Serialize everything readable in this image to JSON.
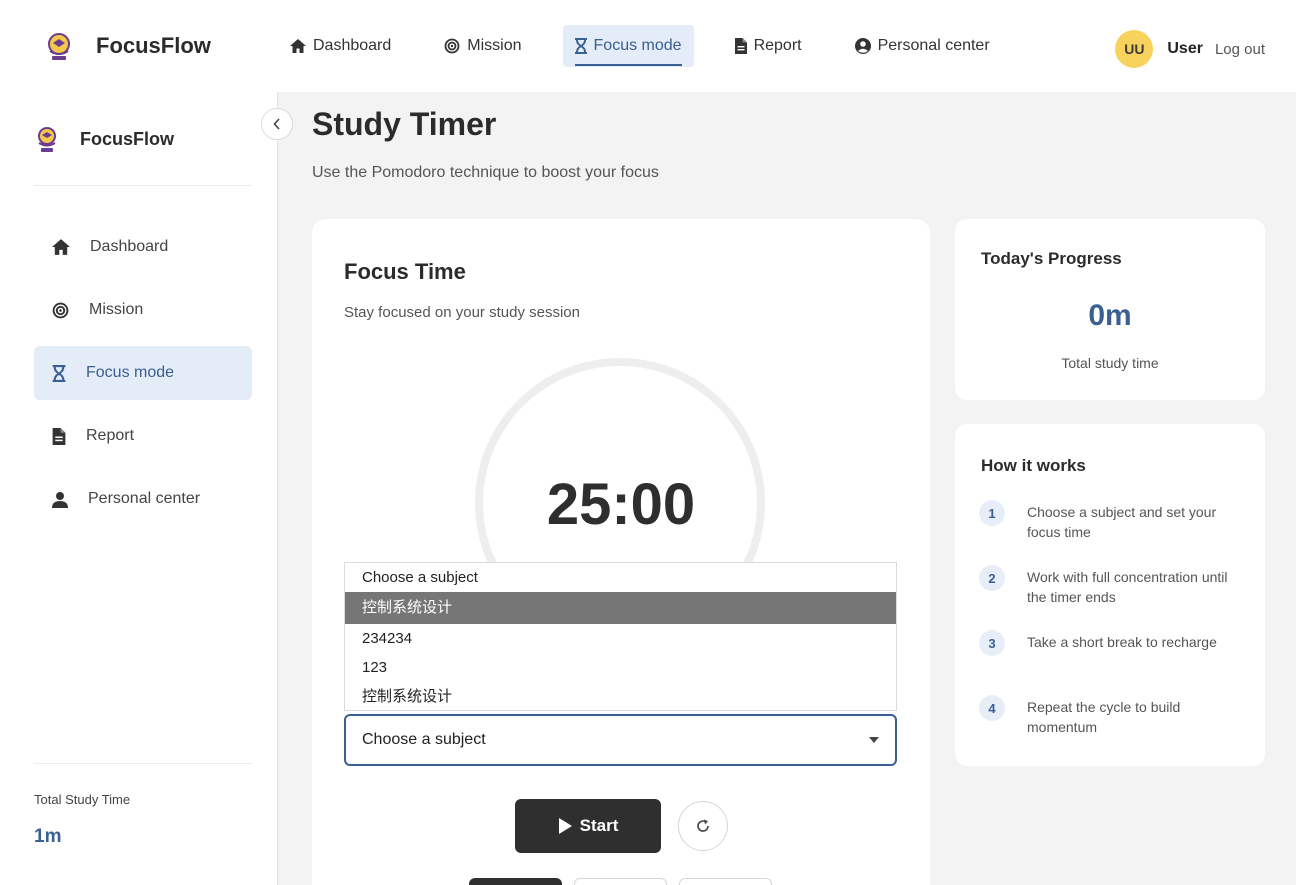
{
  "brand": {
    "name": "FocusFlow"
  },
  "nav": {
    "items": [
      {
        "label": "Dashboard",
        "icon": "home-icon"
      },
      {
        "label": "Mission",
        "icon": "target-icon"
      },
      {
        "label": "Focus mode",
        "icon": "hourglass-icon",
        "active": true
      },
      {
        "label": "Report",
        "icon": "file-icon"
      },
      {
        "label": "Personal center",
        "icon": "user-circle-icon"
      }
    ]
  },
  "user": {
    "initials": "UU",
    "name": "User",
    "logout_label": "Log out"
  },
  "sidebar": {
    "brand": "FocusFlow",
    "items": [
      {
        "label": "Dashboard",
        "icon": "home-icon"
      },
      {
        "label": "Mission",
        "icon": "target-icon"
      },
      {
        "label": "Focus mode",
        "icon": "hourglass-icon",
        "active": true
      },
      {
        "label": "Report",
        "icon": "file-icon"
      },
      {
        "label": "Personal center",
        "icon": "user-icon"
      }
    ],
    "total_label": "Total Study Time",
    "total_value": "1m"
  },
  "page": {
    "title": "Study Timer",
    "subtitle": "Use the Pomodoro technique to boost your focus"
  },
  "timer": {
    "title": "Focus Time",
    "subtitle": "Stay focused on your study session",
    "time": "25:00",
    "subject_options": [
      "Choose a subject",
      "控制系统设计",
      "234234",
      "123",
      "控制系统设计"
    ],
    "highlighted_option": 1,
    "selected_subject": "Choose a subject",
    "start_label": "Start"
  },
  "progress": {
    "title": "Today's Progress",
    "value": "0m",
    "label": "Total study time"
  },
  "how": {
    "title": "How it works",
    "steps": [
      {
        "num": "1",
        "text": "Choose a subject and set your focus time"
      },
      {
        "num": "2",
        "text": "Work with full concentration until the timer ends"
      },
      {
        "num": "3",
        "text": "Take a short break to recharge"
      },
      {
        "num": "4",
        "text": "Repeat the cycle to build momentum"
      }
    ]
  },
  "colors": {
    "accent": "#3a5f92",
    "active_bg": "#e4ecf8",
    "avatar": "#f7d35e",
    "dark_button": "#2f2f2f"
  }
}
